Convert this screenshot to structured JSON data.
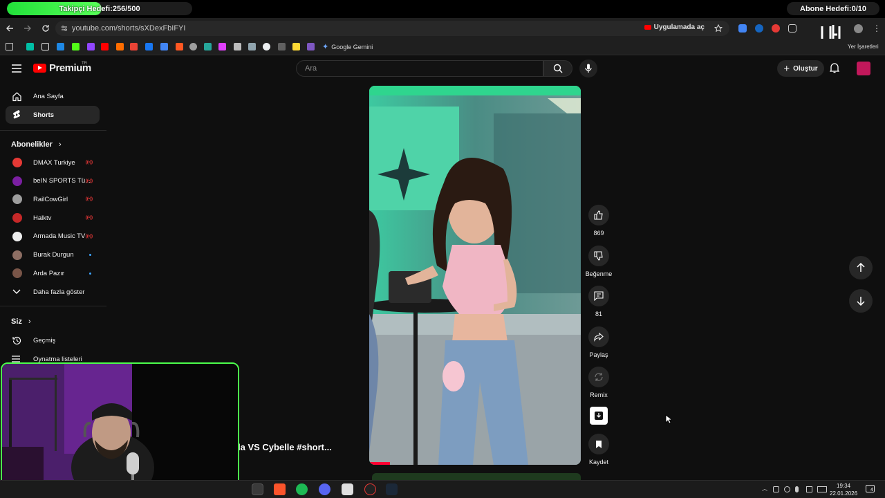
{
  "stream_overlay": {
    "follower_goal": "Takipçi Hedefi:256/500",
    "follower_progress": 0.512,
    "subscriber_goal": "Abone Hedefi:0/10",
    "subscriber_progress": 0.0
  },
  "browser": {
    "url": "youtube.com/shorts/sXDexFbIFYI",
    "open_in_app": "Uygulamada aç",
    "bookmarks": {
      "gemini": "Google Gemini",
      "other": "Yer İşaretleri"
    }
  },
  "header": {
    "logo_text": "Premium",
    "logo_region": "TR",
    "search_placeholder": "Ara",
    "create_label": "Oluştur"
  },
  "sidebar": {
    "main_items": [
      {
        "label": "Ana Sayfa",
        "icon": "home-icon"
      },
      {
        "label": "Shorts",
        "icon": "shorts-icon"
      }
    ],
    "subscriptions_title": "Abonelikler",
    "subscriptions": [
      {
        "label": "DMAX Turkiye",
        "live": true,
        "color": "#e53935"
      },
      {
        "label": "beIN SPORTS Tü...",
        "live": true,
        "color": "#7b1fa2"
      },
      {
        "label": "RailCowGirl",
        "live": true,
        "color": "#9e9e9e"
      },
      {
        "label": "Halktv",
        "live": true,
        "color": "#c62828"
      },
      {
        "label": "Armada Music TV",
        "live": true,
        "color": "#eeeeee"
      },
      {
        "label": "Burak Durgun",
        "live": false,
        "color": "#8d6e63"
      },
      {
        "label": "Arda Pazır",
        "live": false,
        "color": "#795548"
      }
    ],
    "show_more": "Daha fazla göster",
    "you_title": "Siz",
    "you_items": [
      {
        "label": "Geçmiş",
        "icon": "history-icon"
      },
      {
        "label": "Oynatma listeleri",
        "icon": "playlist-icon"
      }
    ]
  },
  "short": {
    "title": "la VS Cybelle #short...",
    "actions": {
      "like_count": "869",
      "dislike_label": "Beğenme",
      "comment_count": "81",
      "share_label": "Paylaş",
      "remix_label": "Remix",
      "save_label": "Kaydet"
    }
  },
  "taskbar": {
    "time": "19:34",
    "date": "22.01.2026",
    "notifications": "4"
  }
}
